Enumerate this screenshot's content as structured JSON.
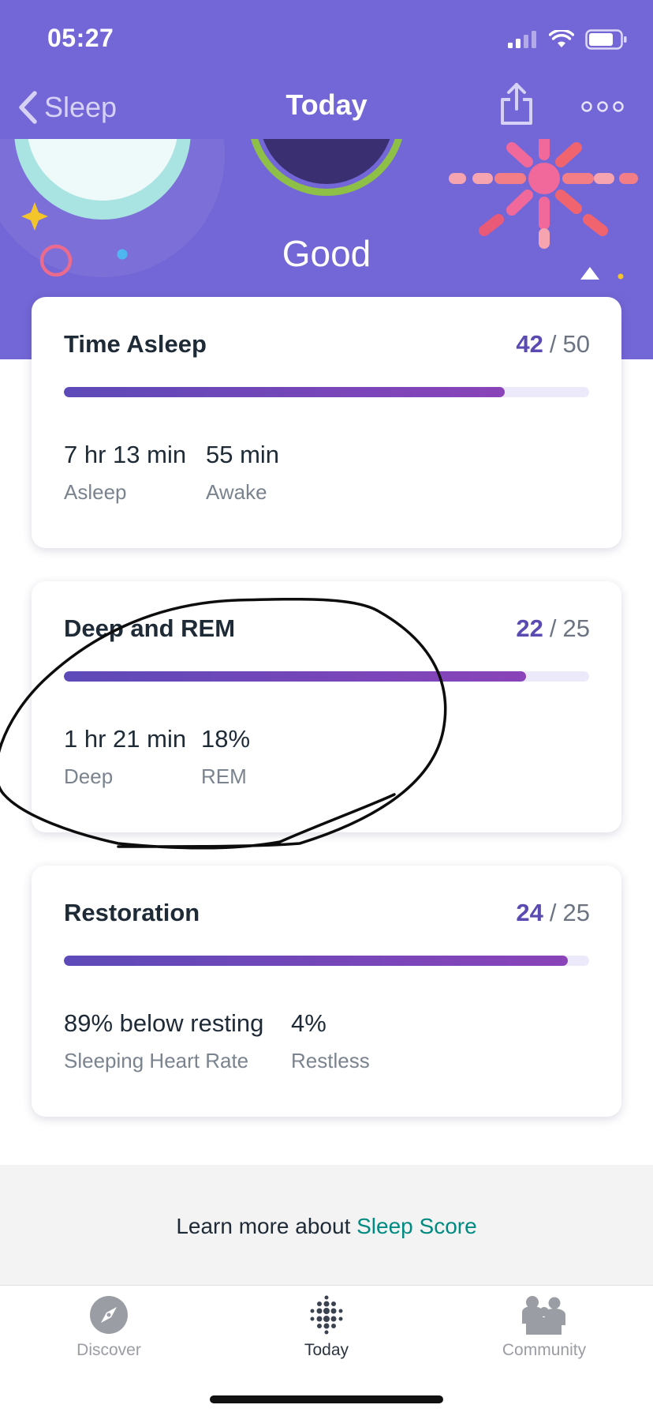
{
  "status_bar": {
    "time": "05:27",
    "signal_icon": "cellular-signal-icon",
    "wifi_icon": "wifi-icon",
    "battery_icon": "battery-icon"
  },
  "nav": {
    "back_label": "Sleep",
    "title": "Today",
    "share_icon": "share-icon",
    "more_icon": "more-options-icon"
  },
  "score": {
    "label": "Good"
  },
  "cards": [
    {
      "title": "Time Asleep",
      "score": "42",
      "max": "50",
      "fraction": 0.84,
      "stats": [
        {
          "value": "7 hr 13 min",
          "label": "Asleep"
        },
        {
          "value": "55 min",
          "label": "Awake"
        }
      ]
    },
    {
      "title": "Deep and REM",
      "score": "22",
      "max": "25",
      "fraction": 0.88,
      "stats": [
        {
          "value": "1 hr 21 min",
          "label": "Deep"
        },
        {
          "value": "18%",
          "label": "REM"
        }
      ]
    },
    {
      "title": "Restoration",
      "score": "24",
      "max": "25",
      "fraction": 0.96,
      "stats": [
        {
          "value": "89% below resting",
          "label": "Sleeping Heart Rate"
        },
        {
          "value": "4%",
          "label": "Restless"
        }
      ]
    }
  ],
  "learn_more": {
    "prefix": "Learn more about ",
    "link": "Sleep Score"
  },
  "tabs": [
    {
      "label": "Discover",
      "icon": "compass-icon",
      "active": false
    },
    {
      "label": "Today",
      "icon": "dots-grid-icon",
      "active": true
    },
    {
      "label": "Community",
      "icon": "people-icon",
      "active": false
    }
  ],
  "colors": {
    "hero_purple": "#7366d6",
    "score_accent": "#5a4bb3",
    "bar_start": "#5d4ab8",
    "bar_end": "#8a43b9",
    "bar_track": "#ece9fb",
    "link_teal": "#008a80"
  }
}
